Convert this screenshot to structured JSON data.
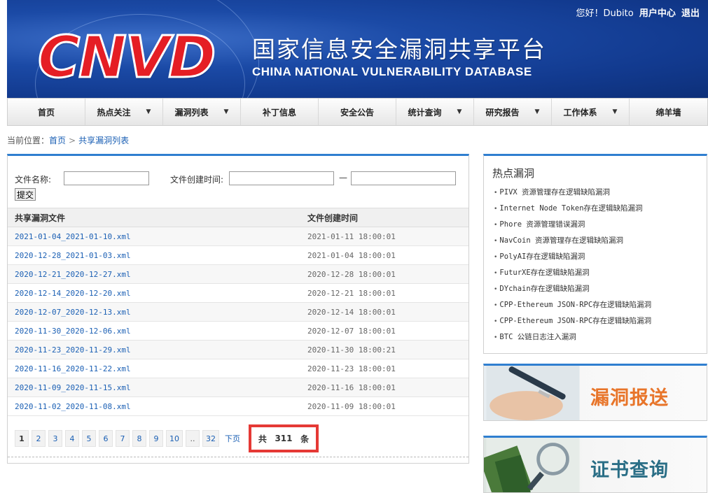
{
  "header": {
    "logo": "CNVD",
    "cn_title": "国家信息安全漏洞共享平台",
    "en_title": "CHINA NATIONAL VULNERABILITY DATABASE",
    "greeting": "您好！Dubito",
    "user_center": "用户中心",
    "logout": "退出"
  },
  "nav": [
    {
      "label": "首页",
      "dropdown": false
    },
    {
      "label": "热点关注",
      "dropdown": true
    },
    {
      "label": "漏洞列表",
      "dropdown": true
    },
    {
      "label": "补丁信息",
      "dropdown": false
    },
    {
      "label": "安全公告",
      "dropdown": false
    },
    {
      "label": "统计查询",
      "dropdown": true
    },
    {
      "label": "研究报告",
      "dropdown": true
    },
    {
      "label": "工作体系",
      "dropdown": true
    },
    {
      "label": "绵羊墙",
      "dropdown": false
    }
  ],
  "breadcrumb": {
    "prefix": "当前位置：",
    "home": "首页",
    "sep": ">",
    "current": "共享漏洞列表"
  },
  "search": {
    "filename_label": "文件名称:",
    "filename_value": "",
    "date_label": "文件创建时间:",
    "date_start": "",
    "dash": "—",
    "date_end": "",
    "submit": "提交"
  },
  "table": {
    "headers": [
      "共享漏洞文件",
      "文件创建时间"
    ],
    "rows": [
      [
        "2021-01-04_2021-01-10.xml",
        "2021-01-11 18:00:01"
      ],
      [
        "2020-12-28_2021-01-03.xml",
        "2021-01-04 18:00:01"
      ],
      [
        "2020-12-21_2020-12-27.xml",
        "2020-12-28 18:00:01"
      ],
      [
        "2020-12-14_2020-12-20.xml",
        "2020-12-21 18:00:01"
      ],
      [
        "2020-12-07_2020-12-13.xml",
        "2020-12-14 18:00:01"
      ],
      [
        "2020-11-30_2020-12-06.xml",
        "2020-12-07 18:00:01"
      ],
      [
        "2020-11-23_2020-11-29.xml",
        "2020-11-30 18:00:21"
      ],
      [
        "2020-11-16_2020-11-22.xml",
        "2020-11-23 18:00:01"
      ],
      [
        "2020-11-09_2020-11-15.xml",
        "2020-11-16 18:00:01"
      ],
      [
        "2020-11-02_2020-11-08.xml",
        "2020-11-09 18:00:01"
      ]
    ]
  },
  "pager": {
    "pages": [
      "1",
      "2",
      "3",
      "4",
      "5",
      "6",
      "7",
      "8",
      "9",
      "10"
    ],
    "ellipsis": "..",
    "last": "32",
    "next": "下页",
    "total_prefix": "共",
    "total": "311",
    "total_suffix": "条",
    "current": "1"
  },
  "hot": {
    "title": "热点漏洞",
    "items": [
      "PIVX 资源管理存在逻辑缺陷漏洞",
      "Internet Node Token存在逻辑缺陷漏洞",
      "Phore 资源管理错误漏洞",
      "NavCoin 资源管理存在逻辑缺陷漏洞",
      "PolyAI存在逻辑缺陷漏洞",
      "FuturXE存在逻辑缺陷漏洞",
      "DYchain存在逻辑缺陷漏洞",
      "CPP-Ethereum JSON-RPC存在逻辑缺陷漏洞",
      "CPP-Ethereum JSON-RPC存在逻辑缺陷漏洞",
      "BTC 公链日志注入漏洞"
    ]
  },
  "side_banners": {
    "report": "漏洞报送",
    "cert": "证书查询"
  },
  "colors": {
    "accent_blue": "#2f7fd0",
    "link": "#1a5fb4",
    "logo_red": "#e51e24",
    "highlight_box": "#e53935"
  }
}
